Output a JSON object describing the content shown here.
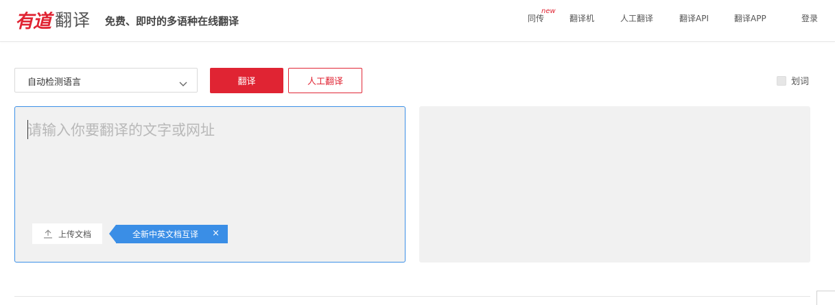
{
  "brand": {
    "logo_text": "有道",
    "product_text": "翻译",
    "slogan": "免费、即时的多语种在线翻译",
    "brand_color": "#e02433"
  },
  "nav": {
    "items": [
      {
        "label": "同传",
        "badge": "new"
      },
      {
        "label": "翻译机"
      },
      {
        "label": "人工翻译"
      },
      {
        "label": "翻译API"
      },
      {
        "label": "翻译APP"
      },
      {
        "label": "登录"
      }
    ]
  },
  "toolbar": {
    "language_select": "自动检测语言",
    "translate_button": "翻译",
    "human_translate_button": "人工翻译",
    "word_pick_label": "划词"
  },
  "input": {
    "placeholder": "请输入你要翻译的文字或网址",
    "value": "",
    "upload_button": "上传文档",
    "promo_text": "全新中英文档互译",
    "promo_close": "×",
    "accent_color": "#3a8ee6"
  },
  "output": {
    "text": ""
  }
}
